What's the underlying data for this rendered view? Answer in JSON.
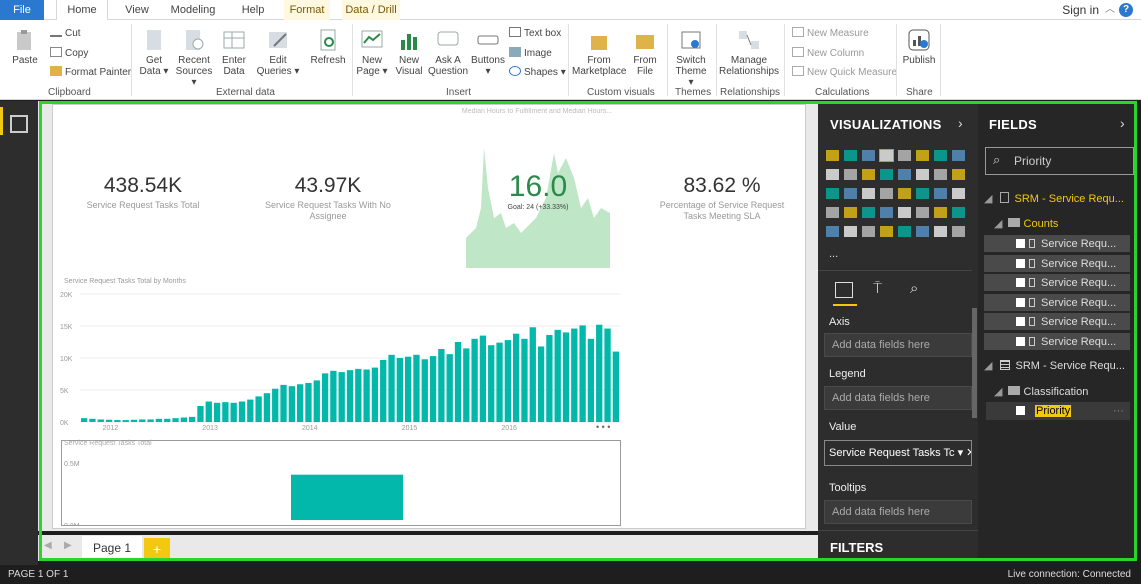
{
  "tabs": {
    "file": "File",
    "home": "Home",
    "view": "View",
    "modeling": "Modeling",
    "help": "Help",
    "format": "Format",
    "data_drill": "Data / Drill"
  },
  "signin": "Sign in",
  "ribbon": {
    "paste": "Paste",
    "cut": "Cut",
    "copy": "Copy",
    "format_painter": "Format Painter",
    "get_data": [
      "Get",
      "Data ▾"
    ],
    "recent_sources": [
      "Recent",
      "Sources ▾"
    ],
    "enter_data": [
      "Enter",
      "Data"
    ],
    "edit_queries": [
      "Edit",
      "Queries ▾"
    ],
    "refresh": "Refresh",
    "new_page": [
      "New",
      "Page ▾"
    ],
    "new_visual": [
      "New",
      "Visual"
    ],
    "ask_question": [
      "Ask A",
      "Question"
    ],
    "buttons": [
      "Buttons",
      "▾"
    ],
    "text_box": "Text box",
    "image": "Image",
    "shapes": "Shapes ▾",
    "from_marketplace": [
      "From",
      "Marketplace"
    ],
    "from_file": [
      "From",
      "File"
    ],
    "switch_theme": [
      "Switch",
      "Theme ▾"
    ],
    "manage_relationships": [
      "Manage",
      "Relationships"
    ],
    "new_measure": "New Measure",
    "new_column": "New Column",
    "new_quick_measure": "New Quick Measure",
    "publish": "Publish",
    "groups": {
      "clipboard": "Clipboard",
      "external": "External data",
      "insert": "Insert",
      "custom": "Custom visuals",
      "themes": "Themes",
      "relationships": "Relationships",
      "calculations": "Calculations",
      "share": "Share"
    }
  },
  "report": {
    "kpis": [
      {
        "value": "438.54K",
        "label": "Service Request Tasks Total"
      },
      {
        "value": "43.97K",
        "label": "Service Request Tasks With No Assignee"
      },
      {
        "value": "83.62 %",
        "label": "Percentage of Service Request Tasks Meeting SLA"
      }
    ],
    "gauge": {
      "title": "Median Hours to Fulfillment and Median Hours...",
      "value": "16.0",
      "goal": "Goal: 24 (+33.33%)"
    },
    "chart_title": "Service Request Tasks Total by Months",
    "chart2_title": "Service Request Tasks Total",
    "more": "• • •"
  },
  "chart_data": [
    {
      "type": "bar",
      "title": "Service Request Tasks Total by Months",
      "ylim": [
        0,
        20000
      ],
      "y_ticks": [
        "20K",
        "15K",
        "10K",
        "5K",
        "0K"
      ],
      "x_ticks": [
        "2012",
        "2013",
        "2014",
        "2015",
        "2016"
      ],
      "values": [
        600,
        500,
        400,
        350,
        300,
        300,
        350,
        400,
        400,
        500,
        500,
        600,
        700,
        800,
        2500,
        3200,
        3000,
        3100,
        3000,
        3200,
        3500,
        4000,
        4500,
        5200,
        5800,
        5600,
        5900,
        6100,
        6500,
        7600,
        8000,
        7800,
        8100,
        8300,
        8200,
        8500,
        9700,
        10500,
        10000,
        10200,
        10500,
        9800,
        10300,
        11400,
        10600,
        12500,
        11500,
        13000,
        13500,
        12000,
        12400,
        12800,
        13800,
        13000,
        14800,
        11800,
        13600,
        14400,
        14000,
        14600,
        15100,
        13000,
        15200,
        14600,
        11000
      ]
    },
    {
      "type": "bar",
      "title": "Service Request Tasks Total",
      "y_ticks": [
        "0.5M",
        "0.0M"
      ],
      "ylim": [
        0,
        600000
      ],
      "values": [
        438540
      ]
    }
  ],
  "viz": {
    "title": "VISUALIZATIONS",
    "ellipsis": "...",
    "axis": "Axis",
    "axis_ph": "Add data fields here",
    "legend": "Legend",
    "legend_ph": "Add data fields here",
    "value": "Value",
    "value_field": "Service Request Tasks Tc ▾  ✕",
    "tooltips": "Tooltips",
    "tooltips_ph": "Add data fields here",
    "filters": "FILTERS"
  },
  "fields": {
    "title": "FIELDS",
    "search": "Priority",
    "table1": "SRM - Service Requ...",
    "folder1": "Counts",
    "items": [
      "Service Requ...",
      "Service Requ...",
      "Service Requ...",
      "Service Requ...",
      "Service Requ...",
      "Service Requ..."
    ],
    "table2": "SRM - Service Requ...",
    "folder2": "Classification",
    "priority": "Priority"
  },
  "pages": {
    "page1": "Page 1",
    "add": "+"
  },
  "status": {
    "page": "PAGE 1 OF 1",
    "connection": "Live connection: Connected"
  },
  "colors": {
    "accent": "#01b8aa",
    "yellow": "#f2c811",
    "green_border": "#2bd42b"
  }
}
